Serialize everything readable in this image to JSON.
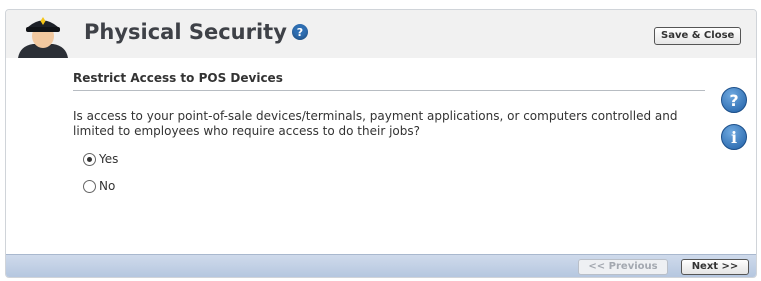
{
  "header": {
    "title": "Physical Security",
    "help_glyph": "?",
    "save_close_label": "Save & Close",
    "avatar_icon": "security-guard-icon"
  },
  "section": {
    "title": "Restrict Access to POS Devices",
    "question": "Is access to your point-of-sale devices/terminals, payment applications, or computers controlled and limited to employees who require access to do their jobs?",
    "options": [
      {
        "label": "Yes",
        "selected": true
      },
      {
        "label": "No",
        "selected": false
      }
    ]
  },
  "side_icons": [
    {
      "name": "help-icon",
      "glyph": "?"
    },
    {
      "name": "info-icon",
      "glyph": "i"
    }
  ],
  "footer": {
    "previous_label": "<< Previous",
    "previous_enabled": false,
    "next_label": "Next >>"
  },
  "colors": {
    "accent_blue": "#2f6fb3",
    "footer_bar": "#c3d2e7",
    "title_text": "#3e4147"
  }
}
